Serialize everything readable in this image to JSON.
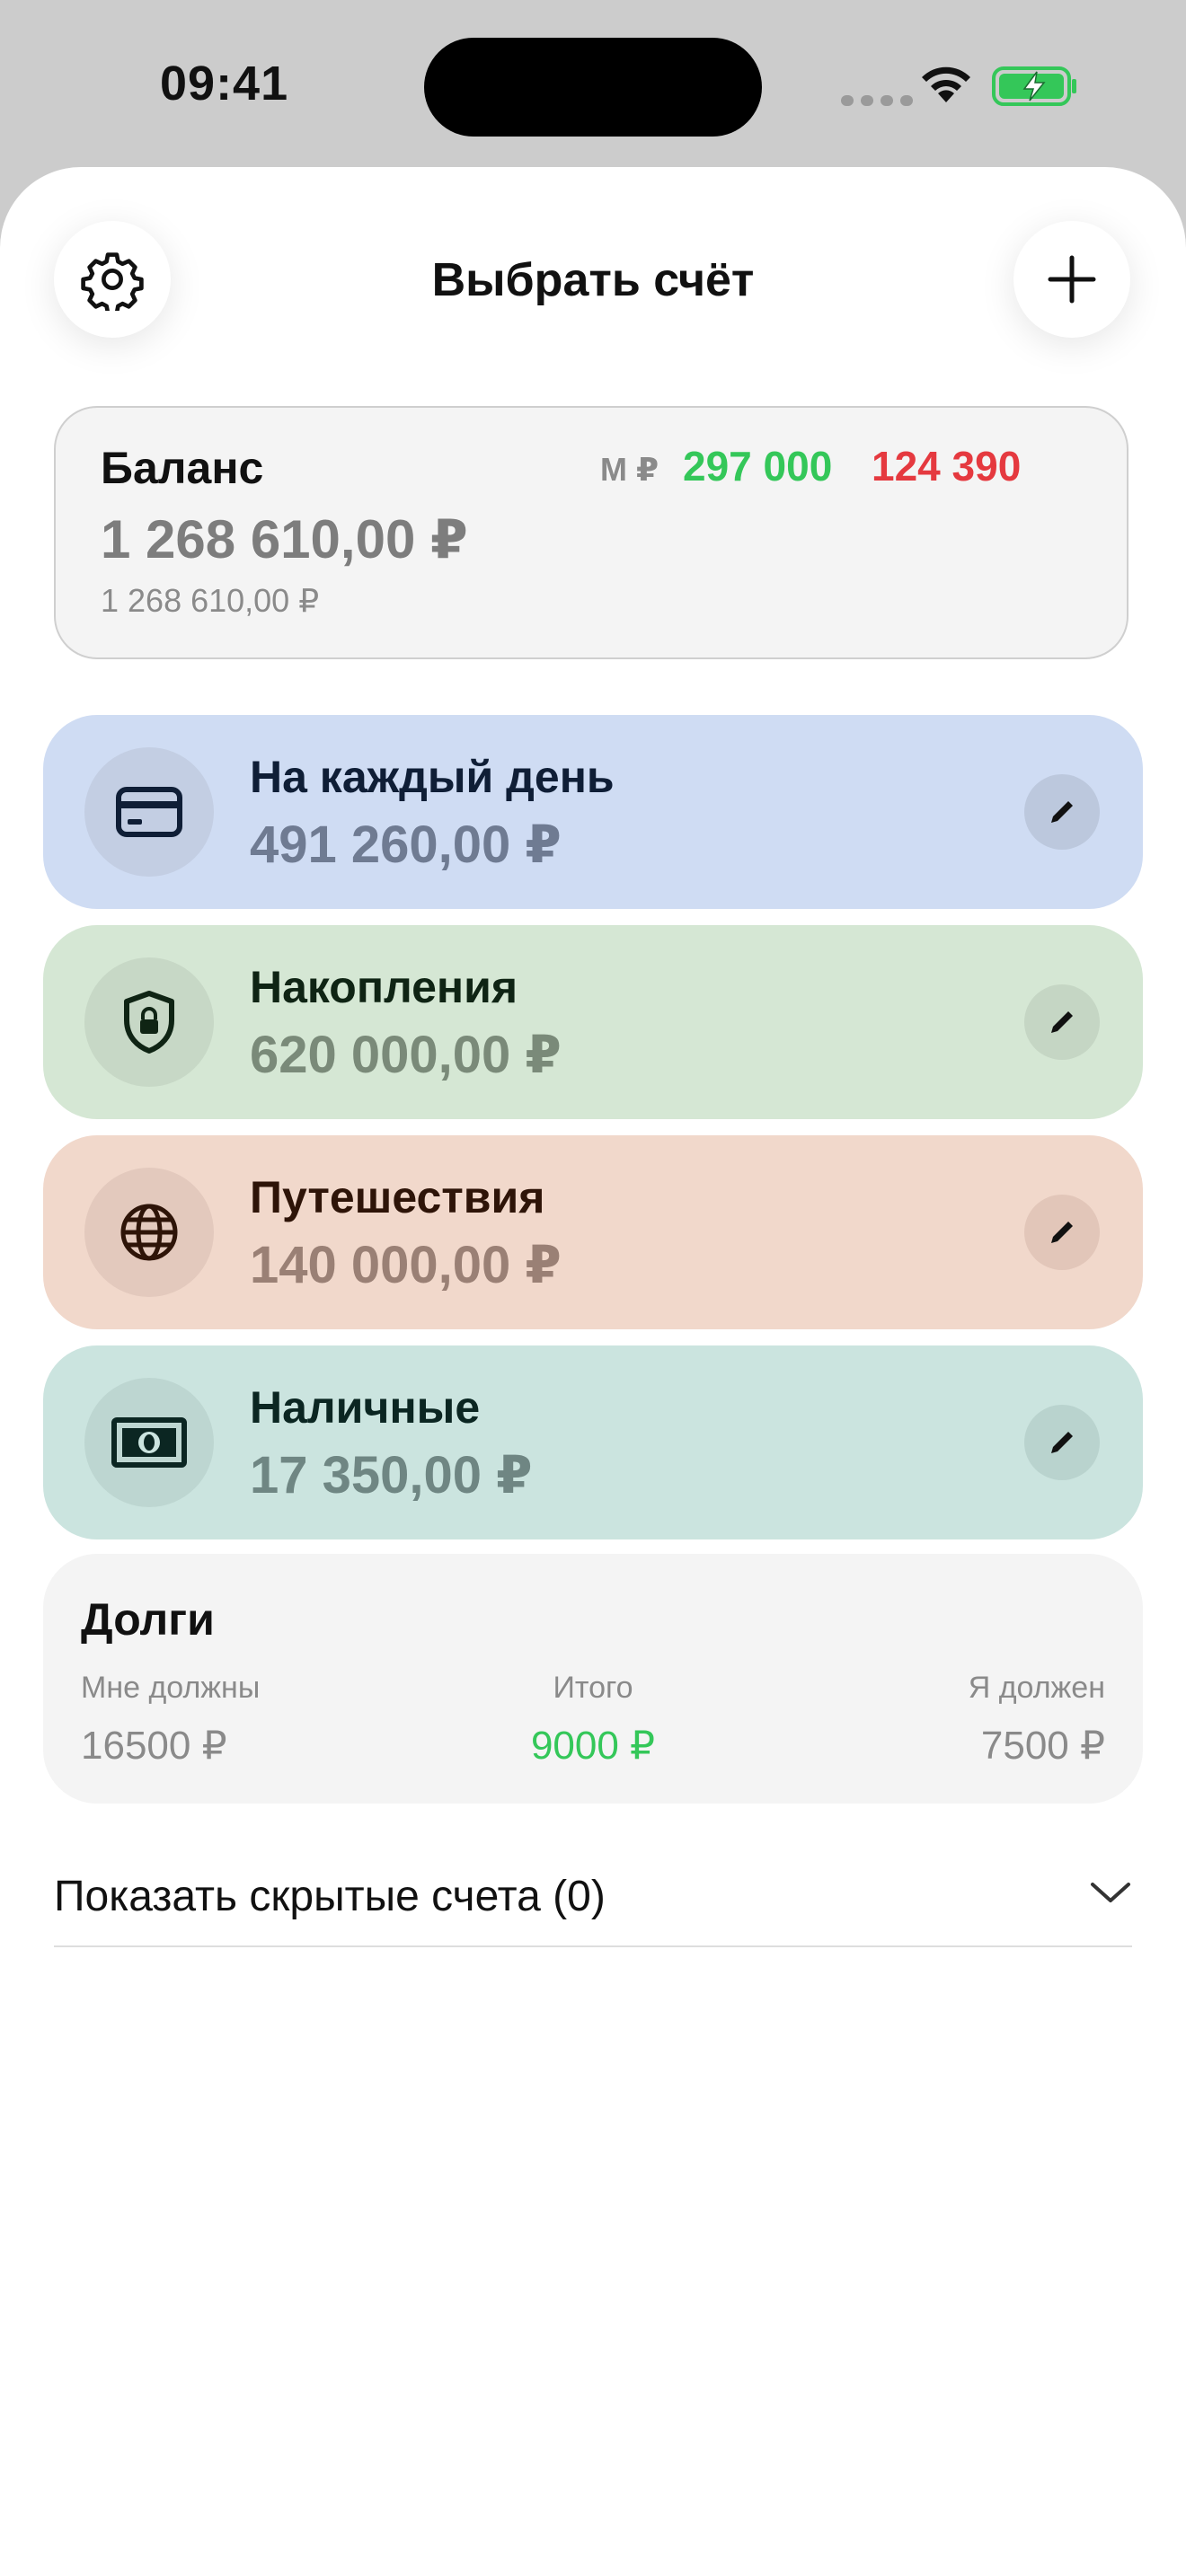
{
  "status_bar": {
    "time": "09:41"
  },
  "header": {
    "title": "Выбрать счёт",
    "settings_icon": "gear-icon",
    "add_icon": "plus-icon"
  },
  "balance": {
    "title": "Баланс",
    "total": "1 268 610,00 ₽",
    "secondary": "1 268 610,00 ₽",
    "period_currency": "М ₽",
    "income": "297 000",
    "expense": "124 390",
    "colors": {
      "income": "#34c759",
      "expense": "#e5393f"
    }
  },
  "accounts": [
    {
      "name": "На каждый день",
      "amount": "491 260,00 ₽",
      "icon": "credit-card-icon",
      "bg": "#cfdcf3",
      "circle": "#c3cee3",
      "name_color": "#0f1e36",
      "amount_color": "#6f7b92"
    },
    {
      "name": "Накопления",
      "amount": "620 000,00 ₽",
      "icon": "shield-lock-icon",
      "bg": "#d5e7d4",
      "circle": "#c7d8c6",
      "name_color": "#0f2414",
      "amount_color": "#7a8a79"
    },
    {
      "name": "Путешествия",
      "amount": "140 000,00 ₽",
      "icon": "globe-icon",
      "bg": "#f1d8cb",
      "circle": "#e3c9bd",
      "name_color": "#2e1408",
      "amount_color": "#9a8075"
    },
    {
      "name": "Наличные",
      "amount": "17 350,00 ₽",
      "icon": "banknote-icon",
      "bg": "#cbe4df",
      "circle": "#bdd6d1",
      "name_color": "#0b2622",
      "amount_color": "#6f8683"
    }
  ],
  "debts": {
    "title": "Долги",
    "owed_to_me_label": "Мне должны",
    "owed_to_me": "16500 ₽",
    "total_label": "Итого",
    "total": "9000 ₽",
    "i_owe_label": "Я должен",
    "i_owe": "7500 ₽",
    "total_color": "#34c759"
  },
  "hidden_accounts": {
    "label": "Показать скрытые счета (0)"
  }
}
